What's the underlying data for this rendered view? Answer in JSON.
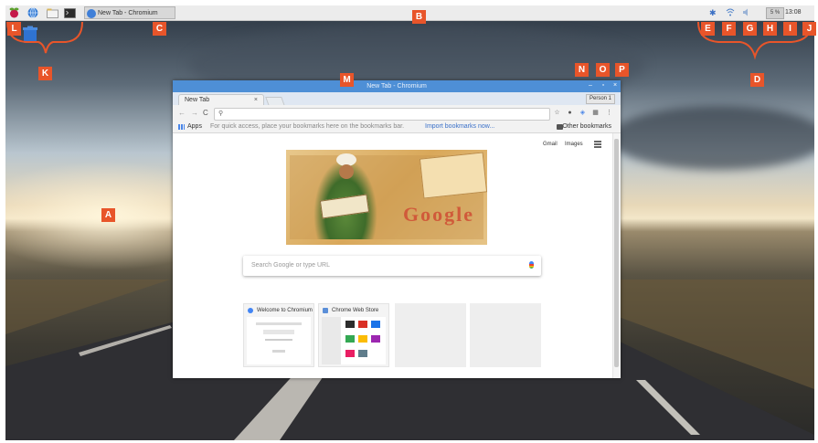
{
  "desktop": {
    "panel": {
      "launchers": [
        {
          "icon": "raspberry-menu-icon",
          "color": "#c51a4a"
        },
        {
          "icon": "globe-browser-icon",
          "color": "#3a7fd6"
        },
        {
          "icon": "file-manager-icon",
          "color": "#d9b65a"
        },
        {
          "icon": "terminal-icon",
          "color": "#2b2b2b"
        }
      ],
      "task_button": {
        "label": "New Tab - Chromium"
      },
      "tray": {
        "icons": [
          "bluetooth-icon",
          "wifi-icon",
          "volume-icon"
        ],
        "cpu_monitor": "5 %",
        "clock": "13:08"
      }
    },
    "desktop_icons": [
      {
        "icon": "trash-icon"
      }
    ]
  },
  "callouts": {
    "A": "A",
    "B": "B",
    "C": "C",
    "D": "D",
    "E": "E",
    "F": "F",
    "G": "G",
    "H": "H",
    "I": "I",
    "J": "J",
    "K": "K",
    "L": "L",
    "M": "M",
    "N": "N",
    "O": "O",
    "P": "P"
  },
  "browser": {
    "window_title": "New Tab - Chromium",
    "tab_label": "New Tab",
    "tab_close": "×",
    "profile_label": "Person 1",
    "nav": {
      "back": "←",
      "forward": "→",
      "reload": "C"
    },
    "address": {
      "value": "",
      "placeholder": ""
    },
    "bookmarks_bar": {
      "apps_label": "Apps",
      "hint": "For quick access, place your bookmarks here on the bookmarks bar.",
      "import_link": "Import bookmarks now...",
      "other_bookmarks": "Other bookmarks"
    },
    "ntp": {
      "links": {
        "gmail": "Gmail",
        "images": "Images"
      },
      "doodle_word": "Google",
      "search_placeholder": "Search Google or type URL",
      "tiles": [
        {
          "title": "Welcome to Chromium"
        },
        {
          "title": "Chrome Web Store"
        },
        {
          "title": ""
        },
        {
          "title": ""
        }
      ]
    },
    "accent_color": "#4e8fd6"
  }
}
